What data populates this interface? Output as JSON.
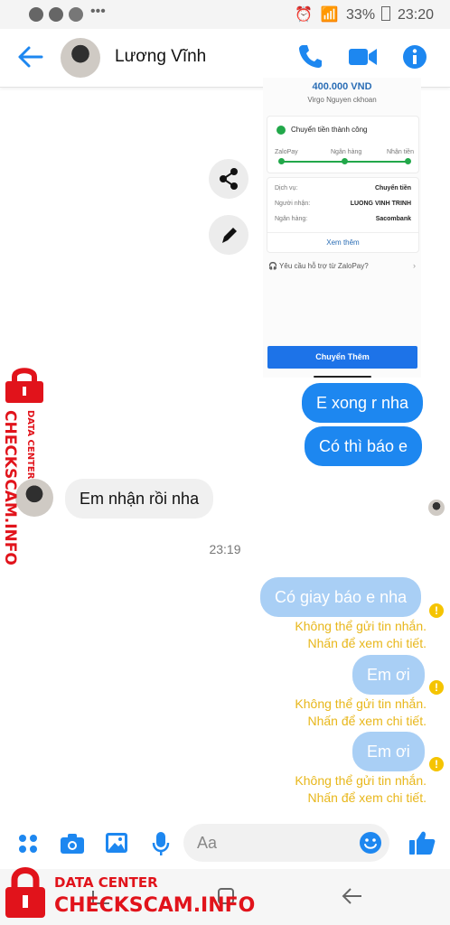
{
  "status_bar": {
    "battery": "33%",
    "time": "23:20"
  },
  "header": {
    "contact_name": "Lương Vĩnh"
  },
  "receipt": {
    "amount": "400.000 VND",
    "recipient_note": "Virgo Nguyen ckhoan",
    "status": "Chuyển tiền thành công",
    "steps": [
      "ZaloPay",
      "Ngân hàng",
      "Nhận tiền"
    ],
    "rows": [
      {
        "label": "Dịch vụ:",
        "value": "Chuyển tiền"
      },
      {
        "label": "Người nhận:",
        "value": "LUONG VINH TRINH"
      },
      {
        "label": "Ngân hàng:",
        "value": "Sacombank"
      }
    ],
    "see_more": "Xem thêm",
    "support": "Yêu cầu hỗ trợ từ ZaloPay?",
    "transfer_more": "Chuyển Thêm"
  },
  "messages": {
    "sent_1": "E xong r nha",
    "sent_2": "Có thì báo e",
    "received_1": "Em nhận rồi nha",
    "timestamp": "23:19",
    "failed_1": "Có giay báo e nha",
    "failed_2": "Em ơi",
    "failed_3": "Em ơi",
    "error_line1": "Không thể gửi tin nhắn.",
    "error_line2": "Nhấn để xem chi tiết."
  },
  "composer": {
    "placeholder": "Aa"
  },
  "watermark": {
    "label": "DATA CENTER",
    "brand": "CHECKSCAM.INFO"
  },
  "colors": {
    "accent": "#1d87f0",
    "failed_bubble": "#a9cff5",
    "error_text": "#e8b71b",
    "watermark": "#e1131b"
  }
}
